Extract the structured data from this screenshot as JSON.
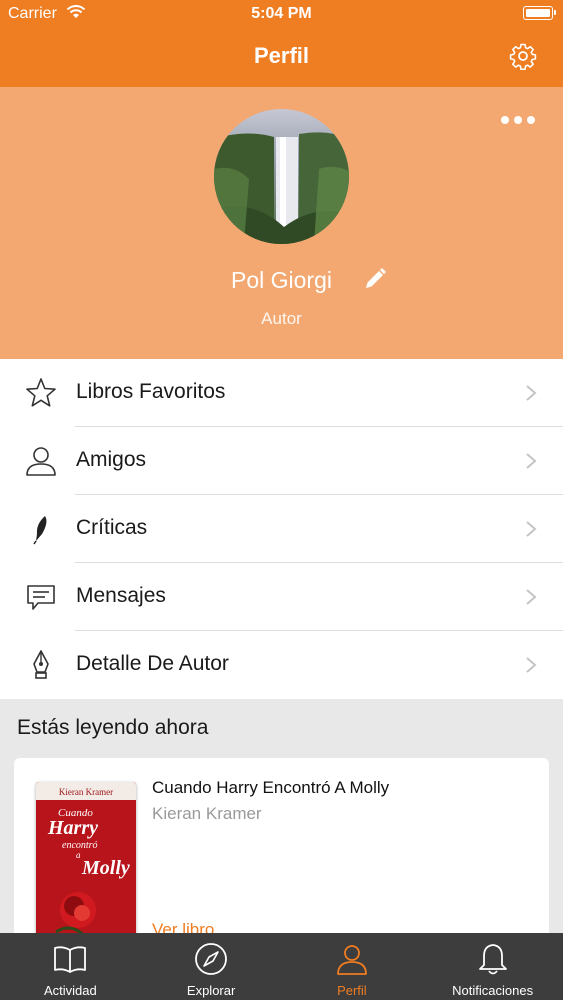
{
  "status_bar": {
    "carrier": "Carrier",
    "time": "5:04 PM"
  },
  "nav": {
    "title": "Perfil",
    "settings_icon": "gear-icon"
  },
  "profile": {
    "name": "Pol Giorgi",
    "role": "Autor",
    "more_icon": "ellipsis-icon",
    "edit_icon": "pencil-icon"
  },
  "menu": [
    {
      "label": "Libros Favoritos",
      "icon": "star-icon"
    },
    {
      "label": "Amigos",
      "icon": "user-icon"
    },
    {
      "label": "Críticas",
      "icon": "feather-icon"
    },
    {
      "label": "Mensajes",
      "icon": "message-icon"
    },
    {
      "label": "Detalle De Autor",
      "icon": "pen-nib-icon"
    }
  ],
  "reading": {
    "section_title": "Estás leyendo ahora",
    "book": {
      "title": "Cuando Harry Encontró A Molly",
      "author": "Kieran Kramer",
      "link": "Ver libro",
      "cover_author": "Kieran Kramer",
      "cover_line1": "Cuando",
      "cover_line2": "Harry",
      "cover_line3": "encontró",
      "cover_line4": "a",
      "cover_line5": "Molly"
    }
  },
  "tabs": [
    {
      "label": "Actividad",
      "icon": "book-icon",
      "active": false
    },
    {
      "label": "Explorar",
      "icon": "compass-icon",
      "active": false
    },
    {
      "label": "Perfil",
      "icon": "user-icon",
      "active": true
    },
    {
      "label": "Notificaciones",
      "icon": "bell-icon",
      "active": false
    }
  ],
  "colors": {
    "accent": "#ef7d22",
    "header_bg": "#f2a870",
    "tabbar_bg": "#3d3d3d"
  }
}
